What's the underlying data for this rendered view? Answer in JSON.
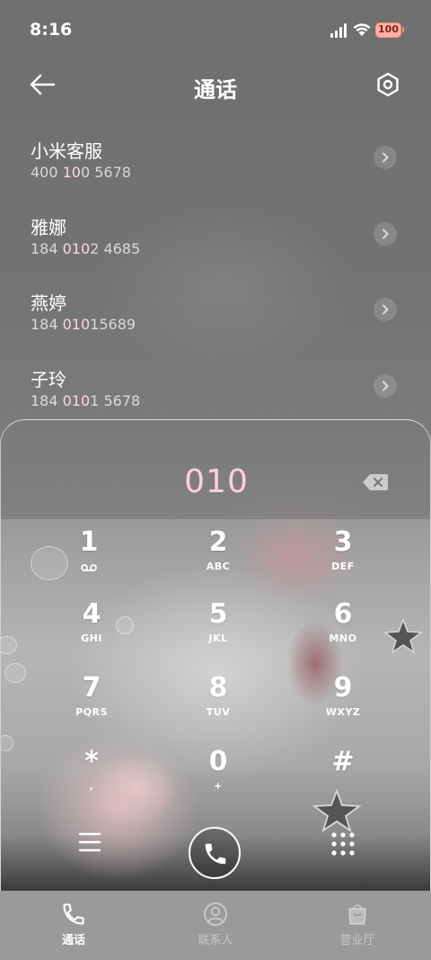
{
  "status_bar": {
    "time": "8:16",
    "battery": "100",
    "icons": [
      "signal-icon",
      "wifi-icon",
      "battery-icon"
    ]
  },
  "header": {
    "title": "通话",
    "back_icon": "arrow-left-icon",
    "settings_icon": "settings-hexagon-icon"
  },
  "contacts": [
    {
      "name": "小米客服",
      "number_pre": "400 ",
      "number_hl": "10",
      "number_post": "0 5678"
    },
    {
      "name": "雅娜",
      "number_pre": "184 ",
      "number_hl": "010",
      "number_post": "2 4685"
    },
    {
      "name": "燕婷",
      "number_pre": "184 ",
      "number_hl": "010",
      "number_post": "15689"
    },
    {
      "name": "子玲",
      "number_pre": "184 ",
      "number_hl": "010",
      "number_post": "1 5678"
    }
  ],
  "dialer": {
    "input": "010",
    "highlight_color": "#ffd2d8",
    "keys": [
      {
        "digit": "1",
        "letters": ""
      },
      {
        "digit": "2",
        "letters": "ABC"
      },
      {
        "digit": "3",
        "letters": "DEF"
      },
      {
        "digit": "4",
        "letters": "GHI"
      },
      {
        "digit": "5",
        "letters": "JKL"
      },
      {
        "digit": "6",
        "letters": "MNO"
      },
      {
        "digit": "7",
        "letters": "PQRS"
      },
      {
        "digit": "8",
        "letters": "TUV"
      },
      {
        "digit": "9",
        "letters": "WXYZ"
      },
      {
        "digit": "*",
        "letters": ","
      },
      {
        "digit": "0",
        "letters": "+"
      },
      {
        "digit": "#",
        "letters": ""
      }
    ]
  },
  "bottom_nav": {
    "tabs": [
      {
        "label": "通话",
        "icon": "phone-icon",
        "active": true
      },
      {
        "label": "联系人",
        "icon": "contact-icon",
        "active": false
      },
      {
        "label": "营业厅",
        "icon": "shop-icon",
        "active": false
      }
    ]
  }
}
